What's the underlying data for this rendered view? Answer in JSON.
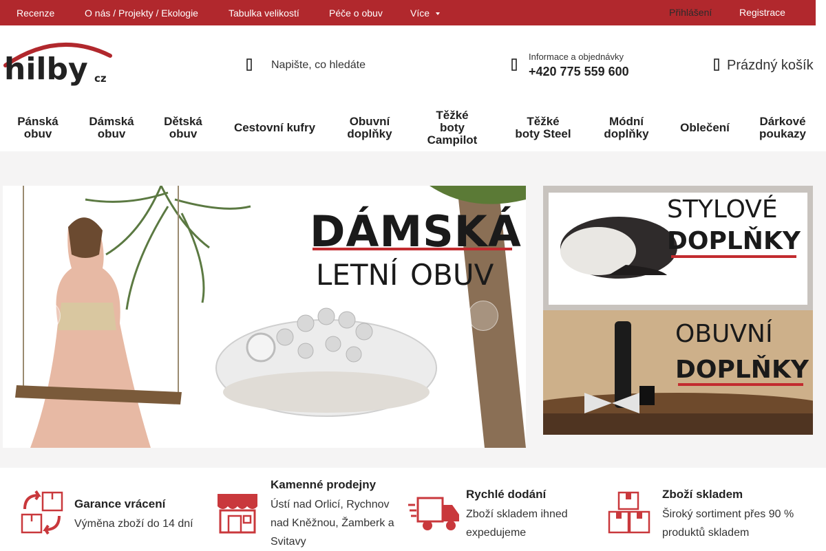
{
  "topbar": {
    "links": [
      "Recenze",
      "O nás / Projekty / Ekologie",
      "Tabulka velikostí",
      "Péče o obuv",
      "Více"
    ],
    "login": "Přihlášení",
    "register": "Registrace"
  },
  "header": {
    "logo_text": "hilby",
    "logo_suffix": "cz",
    "search_placeholder": "Napište, co hledáte",
    "info_label": "Informace a objednávky",
    "phone": "+420 775 559 600",
    "cart": "Prázdný košík"
  },
  "nav": [
    "Pánská\nobuv",
    "Dámská\nobuv",
    "Dětská\nobuv",
    "Cestovní kufry",
    "Obuvní\ndoplňky",
    "Těžké\nboty\nCampilot",
    "Těžké\nboty Steel",
    "Módní\ndoplňky",
    "Oblečení",
    "Dárkové\npoukazy"
  ],
  "hero": {
    "title": "DÁMSKÁ",
    "subtitle_1": "LETNÍ",
    "subtitle_2": "OBUV"
  },
  "side_banners": [
    {
      "line1": "STYLOVÉ",
      "line2": "DOPLŇKY"
    },
    {
      "line1": "OBUVNÍ",
      "line2": "DOPLŇKY"
    }
  ],
  "features": [
    {
      "icon": "return-boxes-icon",
      "title": "Garance vrácení",
      "text": "Výměna zboží do 14 dní"
    },
    {
      "icon": "store-icon",
      "title": "Kamenné prodejny",
      "text": "Ústí nad Orlicí, Rychnov nad Kněžnou, Žamberk a Svitavy"
    },
    {
      "icon": "delivery-truck-icon",
      "title": "Rychlé dodání",
      "text": "Zboží skladem ihned expedujeme"
    },
    {
      "icon": "stock-boxes-icon",
      "title": "Zboží skladem",
      "text": "Široký sortiment přes 90 % produktů skladem"
    }
  ],
  "colors": {
    "brand_red": "#b1282d",
    "icon_red": "#c9383c"
  }
}
